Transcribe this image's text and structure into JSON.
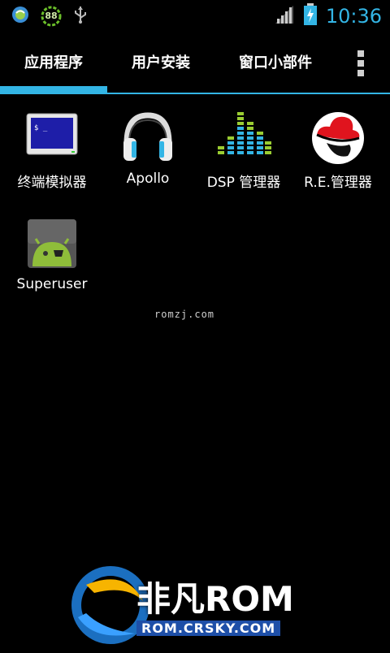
{
  "status_bar": {
    "time": "10:36",
    "notifications": [
      "app-notification-icon",
      "battery-percent-icon",
      "usb-icon"
    ],
    "battery_percent_badge": "88",
    "signal_icon": "signal-icon",
    "battery_icon": "battery-charging-icon"
  },
  "tabs": [
    {
      "label": "应用程序",
      "selected": true
    },
    {
      "label": "用户安装",
      "selected": false
    },
    {
      "label": "窗口小部件",
      "selected": false
    }
  ],
  "overflow_menu_icon": "overflow-menu-icon",
  "apps": [
    {
      "label": "终端模拟器",
      "icon": "terminal-icon"
    },
    {
      "label": "Apollo",
      "icon": "headphones-icon"
    },
    {
      "label": "DSP 管理器",
      "icon": "equalizer-icon"
    },
    {
      "label": "R.E.管理器",
      "icon": "redhat-icon"
    },
    {
      "label": "Superuser",
      "icon": "android-superuser-icon"
    }
  ],
  "watermark_text": "romzj.com",
  "logo": {
    "text_top": "非凡ROM",
    "text_bottom": "ROM.CRSKY.COM"
  },
  "colors": {
    "accent": "#33b5e5",
    "background": "#000000"
  }
}
